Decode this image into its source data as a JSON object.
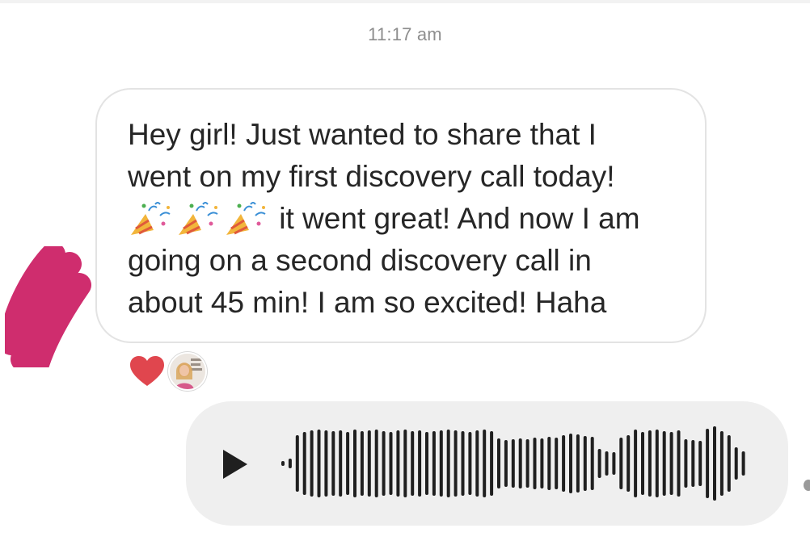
{
  "thread": {
    "timestamp": "11:17 am"
  },
  "incoming_message": {
    "lines": [
      "Hey girl! Just wanted to share that I",
      "went on my first discovery call today!",
      "it went great! And now I am",
      "going on a second discovery call in",
      "about 45 min! I am so excited! Haha"
    ],
    "emojis": [
      "party-popper-icon",
      "party-popper-icon",
      "party-popper-icon"
    ]
  },
  "reactions": {
    "items": [
      "heart-icon"
    ]
  },
  "voice_message": {
    "icon": "play-icon"
  },
  "colors": {
    "text": "#262626",
    "timestamp": "#8e8e8e",
    "bubble_border": "#e3e3e3",
    "voice_bg": "#efefef",
    "heart": "#e0464e",
    "waveform": "#1f1f1f",
    "redaction": "#cf2d6e"
  }
}
